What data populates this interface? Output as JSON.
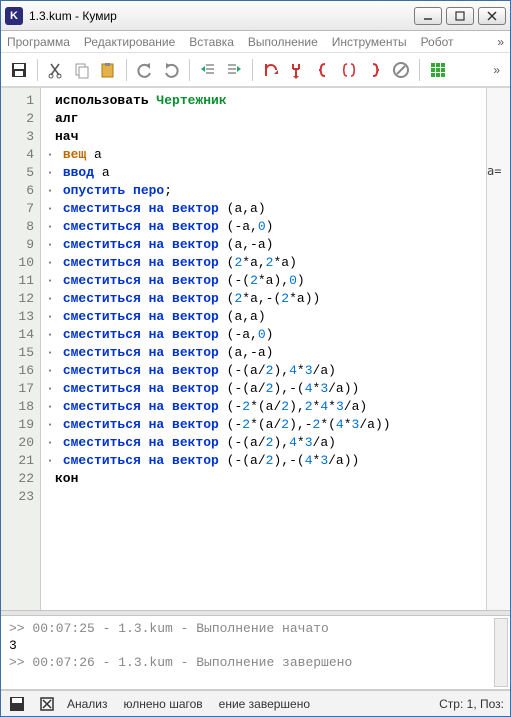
{
  "window": {
    "app_icon_letter": "K",
    "title": "1.3.kum - Кумир"
  },
  "menu": {
    "items": [
      "Программа",
      "Редактирование",
      "Вставка",
      "Выполнение",
      "Инструменты",
      "Робот"
    ]
  },
  "toolbar_icons": [
    "save-icon",
    "cut-icon",
    "copy-icon",
    "paste-icon",
    "undo-icon",
    "redo-icon",
    "outdent-icon",
    "indent-icon",
    "run-icon",
    "step-icon",
    "brace-open-icon",
    "brace-pair-icon",
    "brace-close-icon",
    "stop-icon",
    "grid-icon"
  ],
  "code": {
    "lines": [
      {
        "n": 1,
        "segs": [
          {
            "t": "использовать ",
            "c": "kw-use"
          },
          {
            "t": "Чертежник",
            "c": "kw-green"
          }
        ]
      },
      {
        "n": 2,
        "segs": [
          {
            "t": "алг",
            "c": "kw-use"
          }
        ]
      },
      {
        "n": 3,
        "segs": [
          {
            "t": "нач",
            "c": "kw-use"
          }
        ]
      },
      {
        "n": 4,
        "dot": true,
        "segs": [
          {
            "t": "вещ",
            "c": "kw-orange"
          },
          {
            "t": " а",
            "c": ""
          }
        ]
      },
      {
        "n": 5,
        "dot": true,
        "segs": [
          {
            "t": "ввод",
            "c": "kw-blue"
          },
          {
            "t": " а",
            "c": ""
          }
        ]
      },
      {
        "n": 6,
        "dot": true,
        "segs": [
          {
            "t": "опустить перо",
            "c": "kw-blue"
          },
          {
            "t": ";",
            "c": ""
          }
        ]
      },
      {
        "n": 7,
        "dot": true,
        "segs": [
          {
            "t": "сместиться на вектор",
            "c": "kw-blue"
          },
          {
            "t": " (а,а)",
            "c": "paren"
          }
        ]
      },
      {
        "n": 8,
        "dot": true,
        "segs": [
          {
            "t": "сместиться на вектор",
            "c": "kw-blue"
          },
          {
            "t": " (-а,",
            "c": "paren"
          },
          {
            "t": "0",
            "c": "num"
          },
          {
            "t": ")",
            "c": "paren"
          }
        ]
      },
      {
        "n": 9,
        "dot": true,
        "segs": [
          {
            "t": "сместиться на вектор",
            "c": "kw-blue"
          },
          {
            "t": " (а,-а)",
            "c": "paren"
          }
        ]
      },
      {
        "n": 10,
        "dot": true,
        "segs": [
          {
            "t": "сместиться на вектор",
            "c": "kw-blue"
          },
          {
            "t": " (",
            "c": "paren"
          },
          {
            "t": "2",
            "c": "num"
          },
          {
            "t": "*а,",
            "c": "paren"
          },
          {
            "t": "2",
            "c": "num"
          },
          {
            "t": "*а)",
            "c": "paren"
          }
        ]
      },
      {
        "n": 11,
        "dot": true,
        "segs": [
          {
            "t": "сместиться на вектор",
            "c": "kw-blue"
          },
          {
            "t": " (-(",
            "c": "paren"
          },
          {
            "t": "2",
            "c": "num"
          },
          {
            "t": "*а),",
            "c": "paren"
          },
          {
            "t": "0",
            "c": "num"
          },
          {
            "t": ")",
            "c": "paren"
          }
        ]
      },
      {
        "n": 12,
        "dot": true,
        "segs": [
          {
            "t": "сместиться на вектор",
            "c": "kw-blue"
          },
          {
            "t": " (",
            "c": "paren"
          },
          {
            "t": "2",
            "c": "num"
          },
          {
            "t": "*а,-(",
            "c": "paren"
          },
          {
            "t": "2",
            "c": "num"
          },
          {
            "t": "*а))",
            "c": "paren"
          }
        ]
      },
      {
        "n": 13,
        "dot": true,
        "segs": [
          {
            "t": "сместиться на вектор",
            "c": "kw-blue"
          },
          {
            "t": " (а,а)",
            "c": "paren"
          }
        ]
      },
      {
        "n": 14,
        "dot": true,
        "segs": [
          {
            "t": "сместиться на вектор",
            "c": "kw-blue"
          },
          {
            "t": " (-а,",
            "c": "paren"
          },
          {
            "t": "0",
            "c": "num"
          },
          {
            "t": ")",
            "c": "paren"
          }
        ]
      },
      {
        "n": 15,
        "dot": true,
        "segs": [
          {
            "t": "сместиться на вектор",
            "c": "kw-blue"
          },
          {
            "t": " (а,-а)",
            "c": "paren"
          }
        ]
      },
      {
        "n": 16,
        "dot": true,
        "segs": [
          {
            "t": "сместиться на вектор",
            "c": "kw-blue"
          },
          {
            "t": " (-(а/",
            "c": "paren"
          },
          {
            "t": "2",
            "c": "num"
          },
          {
            "t": "),",
            "c": "paren"
          },
          {
            "t": "4",
            "c": "num"
          },
          {
            "t": "*",
            "c": "paren"
          },
          {
            "t": "3",
            "c": "num"
          },
          {
            "t": "/а)",
            "c": "paren"
          }
        ]
      },
      {
        "n": 17,
        "dot": true,
        "segs": [
          {
            "t": "сместиться на вектор",
            "c": "kw-blue"
          },
          {
            "t": " (-(а/",
            "c": "paren"
          },
          {
            "t": "2",
            "c": "num"
          },
          {
            "t": "),-(",
            "c": "paren"
          },
          {
            "t": "4",
            "c": "num"
          },
          {
            "t": "*",
            "c": "paren"
          },
          {
            "t": "3",
            "c": "num"
          },
          {
            "t": "/а))",
            "c": "paren"
          }
        ]
      },
      {
        "n": 18,
        "dot": true,
        "segs": [
          {
            "t": "сместиться на вектор",
            "c": "kw-blue"
          },
          {
            "t": " (-",
            "c": "paren"
          },
          {
            "t": "2",
            "c": "num"
          },
          {
            "t": "*(а/",
            "c": "paren"
          },
          {
            "t": "2",
            "c": "num"
          },
          {
            "t": "),",
            "c": "paren"
          },
          {
            "t": "2",
            "c": "num"
          },
          {
            "t": "*",
            "c": "paren"
          },
          {
            "t": "4",
            "c": "num"
          },
          {
            "t": "*",
            "c": "paren"
          },
          {
            "t": "3",
            "c": "num"
          },
          {
            "t": "/а)",
            "c": "paren"
          }
        ]
      },
      {
        "n": 19,
        "dot": true,
        "segs": [
          {
            "t": "сместиться на вектор",
            "c": "kw-blue"
          },
          {
            "t": " (-",
            "c": "paren"
          },
          {
            "t": "2",
            "c": "num"
          },
          {
            "t": "*(а/",
            "c": "paren"
          },
          {
            "t": "2",
            "c": "num"
          },
          {
            "t": "),-",
            "c": "paren"
          },
          {
            "t": "2",
            "c": "num"
          },
          {
            "t": "*(",
            "c": "paren"
          },
          {
            "t": "4",
            "c": "num"
          },
          {
            "t": "*",
            "c": "paren"
          },
          {
            "t": "3",
            "c": "num"
          },
          {
            "t": "/а))",
            "c": "paren"
          }
        ]
      },
      {
        "n": 20,
        "dot": true,
        "segs": [
          {
            "t": "сместиться на вектор",
            "c": "kw-blue"
          },
          {
            "t": " (-(а/",
            "c": "paren"
          },
          {
            "t": "2",
            "c": "num"
          },
          {
            "t": "),",
            "c": "paren"
          },
          {
            "t": "4",
            "c": "num"
          },
          {
            "t": "*",
            "c": "paren"
          },
          {
            "t": "3",
            "c": "num"
          },
          {
            "t": "/а)",
            "c": "paren"
          }
        ]
      },
      {
        "n": 21,
        "dot": true,
        "segs": [
          {
            "t": "сместиться на вектор",
            "c": "kw-blue"
          },
          {
            "t": " (-(а/",
            "c": "paren"
          },
          {
            "t": "2",
            "c": "num"
          },
          {
            "t": "),-(",
            "c": "paren"
          },
          {
            "t": "4",
            "c": "num"
          },
          {
            "t": "*",
            "c": "paren"
          },
          {
            "t": "3",
            "c": "num"
          },
          {
            "t": "/а))",
            "c": "paren"
          }
        ]
      },
      {
        "n": 22,
        "segs": [
          {
            "t": "кон",
            "c": "kw-use"
          }
        ]
      },
      {
        "n": 23,
        "segs": []
      }
    ]
  },
  "right_col": "а=",
  "console": {
    "lines": [
      ">> 00:07:25 - 1.3.kum - Выполнение начато",
      "3",
      ">> 00:07:26 - 1.3.kum - Выполнение завершено"
    ]
  },
  "status": {
    "analysis": "Анализ",
    "steps": "юлнено шагов",
    "done": "ение завершено",
    "pos": "Стр: 1, Поз:"
  }
}
